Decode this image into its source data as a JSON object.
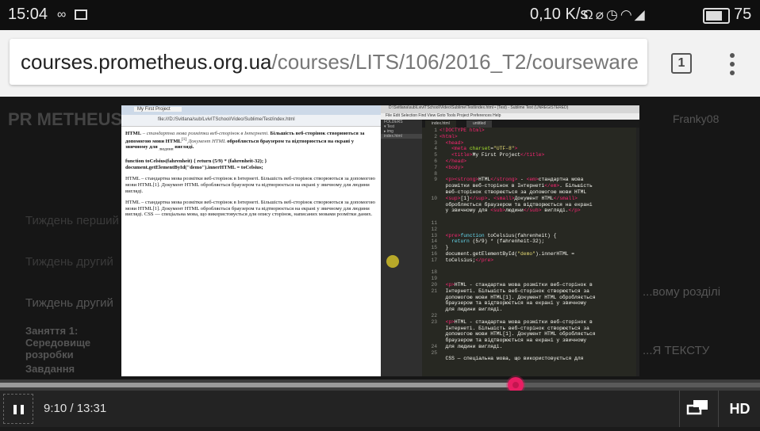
{
  "status_bar": {
    "time": "15:04",
    "icons": [
      "infinity-icon",
      "image-icon",
      "headset-icon",
      "mute-icon",
      "alarm-icon",
      "wifi-icon",
      "signal-3g-icon",
      "battery-icon"
    ],
    "net_speed": "0,10 K/s",
    "battery": "75"
  },
  "browser": {
    "url_host": "courses.prometheus.org.ua",
    "url_path": "/courses/LITS/106/2016_T2/courseware",
    "tab_count": "1"
  },
  "page_background": {
    "logo": "PR METHEUS",
    "user": "Franky08",
    "items": [
      "Тиждень перший",
      "Тиждень другий",
      "Тиждень другий",
      "Заняття 1: Середовище розробки",
      "Завдання"
    ],
    "right_text": "...вому розділі",
    "right_text2": "...Я ТЕКСТУ"
  },
  "video_frame": {
    "browser_tab": "My First Project",
    "browser_address": "file:///D:/Svitlana/sub/LvivITSchool/Video/Sublime/Test/index.html",
    "html_p1_a": "HTML",
    "html_p1_b": " – стандартна мова розмітки веб-сторінок в Інтернеті. ",
    "html_p1_c": "Більшість веб-сторінок створюються за допомогою мови HTML",
    "html_p1_d": "[1]",
    "html_p1_e": " Документ HTML ",
    "html_p1_f": "обробляється браузером та відтворюється на екрані у звичному для ",
    "html_p1_g": "людини",
    "html_p1_h": " вигляді.",
    "html_p2": "function toCelsius(fahrenheit) { return (5/9) * (fahrenheit-32); } document.getElementById(\"demo\").innerHTML = toCelsius;",
    "html_p3": "HTML – стандартна мова розмітки веб-сторінок в Інтернеті. Більшість веб-сторінок створюються за допомогою мови HTML[1]. Документ HTML обробляється браузером та відтворюється на екрані у звичному для людини вигляді.",
    "html_p4": "HTML – стандартна мова розмітки веб-сторінок в Інтернеті. Більшість веб-сторінок створюються за допомогою мови HTML[1]. Документ HTML обробляється браузером та відтворюється на екрані у звичному для людини вигляді. CSS — спеціальна мова, що використовується для опису сторінок, написаних мовами розмітки даних.",
    "editor_title": "D:\\Svitlana\\sub\\LvivITSchool\\Video\\Sublime\\Test\\index.html • (Test) - Sublime Text (UNREGISTERED)",
    "editor_menu": "File  Edit  Selection  Find  View  Goto  Tools  Project  Preferences  Help",
    "editor_tabs": [
      "index.html",
      "untitled"
    ],
    "sidebar": [
      "FOLDERS",
      "▾ Test",
      "  ▸ img",
      "  index.html"
    ],
    "line_numbers": [
      "1",
      "2",
      "3",
      "4",
      "5",
      "6",
      "7",
      "8",
      "9",
      "",
      "",
      "10",
      "",
      "",
      "",
      "11",
      "12",
      "13",
      "14",
      "15",
      "16",
      "17",
      "",
      "18",
      "19",
      "20",
      "21",
      "",
      "",
      "",
      "22",
      "23",
      "",
      "",
      "",
      "24",
      "25"
    ]
  },
  "player": {
    "current_time": "9:10",
    "duration": "13:31",
    "time_display": "9:10 / 13:31",
    "progress": 0.678,
    "hd_label": "HD",
    "accent_color": "#e91e63"
  }
}
